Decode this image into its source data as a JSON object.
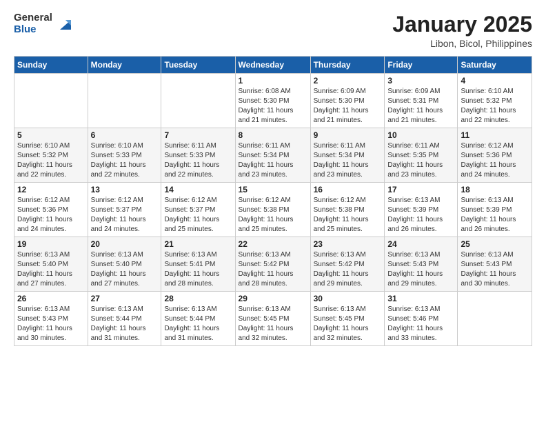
{
  "logo": {
    "general": "General",
    "blue": "Blue"
  },
  "title": "January 2025",
  "subtitle": "Libon, Bicol, Philippines",
  "days_header": [
    "Sunday",
    "Monday",
    "Tuesday",
    "Wednesday",
    "Thursday",
    "Friday",
    "Saturday"
  ],
  "weeks": [
    [
      {
        "day": "",
        "info": ""
      },
      {
        "day": "",
        "info": ""
      },
      {
        "day": "",
        "info": ""
      },
      {
        "day": "1",
        "info": "Sunrise: 6:08 AM\nSunset: 5:30 PM\nDaylight: 11 hours\nand 21 minutes."
      },
      {
        "day": "2",
        "info": "Sunrise: 6:09 AM\nSunset: 5:30 PM\nDaylight: 11 hours\nand 21 minutes."
      },
      {
        "day": "3",
        "info": "Sunrise: 6:09 AM\nSunset: 5:31 PM\nDaylight: 11 hours\nand 21 minutes."
      },
      {
        "day": "4",
        "info": "Sunrise: 6:10 AM\nSunset: 5:32 PM\nDaylight: 11 hours\nand 22 minutes."
      }
    ],
    [
      {
        "day": "5",
        "info": "Sunrise: 6:10 AM\nSunset: 5:32 PM\nDaylight: 11 hours\nand 22 minutes."
      },
      {
        "day": "6",
        "info": "Sunrise: 6:10 AM\nSunset: 5:33 PM\nDaylight: 11 hours\nand 22 minutes."
      },
      {
        "day": "7",
        "info": "Sunrise: 6:11 AM\nSunset: 5:33 PM\nDaylight: 11 hours\nand 22 minutes."
      },
      {
        "day": "8",
        "info": "Sunrise: 6:11 AM\nSunset: 5:34 PM\nDaylight: 11 hours\nand 23 minutes."
      },
      {
        "day": "9",
        "info": "Sunrise: 6:11 AM\nSunset: 5:34 PM\nDaylight: 11 hours\nand 23 minutes."
      },
      {
        "day": "10",
        "info": "Sunrise: 6:11 AM\nSunset: 5:35 PM\nDaylight: 11 hours\nand 23 minutes."
      },
      {
        "day": "11",
        "info": "Sunrise: 6:12 AM\nSunset: 5:36 PM\nDaylight: 11 hours\nand 24 minutes."
      }
    ],
    [
      {
        "day": "12",
        "info": "Sunrise: 6:12 AM\nSunset: 5:36 PM\nDaylight: 11 hours\nand 24 minutes."
      },
      {
        "day": "13",
        "info": "Sunrise: 6:12 AM\nSunset: 5:37 PM\nDaylight: 11 hours\nand 24 minutes."
      },
      {
        "day": "14",
        "info": "Sunrise: 6:12 AM\nSunset: 5:37 PM\nDaylight: 11 hours\nand 25 minutes."
      },
      {
        "day": "15",
        "info": "Sunrise: 6:12 AM\nSunset: 5:38 PM\nDaylight: 11 hours\nand 25 minutes."
      },
      {
        "day": "16",
        "info": "Sunrise: 6:12 AM\nSunset: 5:38 PM\nDaylight: 11 hours\nand 25 minutes."
      },
      {
        "day": "17",
        "info": "Sunrise: 6:13 AM\nSunset: 5:39 PM\nDaylight: 11 hours\nand 26 minutes."
      },
      {
        "day": "18",
        "info": "Sunrise: 6:13 AM\nSunset: 5:39 PM\nDaylight: 11 hours\nand 26 minutes."
      }
    ],
    [
      {
        "day": "19",
        "info": "Sunrise: 6:13 AM\nSunset: 5:40 PM\nDaylight: 11 hours\nand 27 minutes."
      },
      {
        "day": "20",
        "info": "Sunrise: 6:13 AM\nSunset: 5:40 PM\nDaylight: 11 hours\nand 27 minutes."
      },
      {
        "day": "21",
        "info": "Sunrise: 6:13 AM\nSunset: 5:41 PM\nDaylight: 11 hours\nand 28 minutes."
      },
      {
        "day": "22",
        "info": "Sunrise: 6:13 AM\nSunset: 5:42 PM\nDaylight: 11 hours\nand 28 minutes."
      },
      {
        "day": "23",
        "info": "Sunrise: 6:13 AM\nSunset: 5:42 PM\nDaylight: 11 hours\nand 29 minutes."
      },
      {
        "day": "24",
        "info": "Sunrise: 6:13 AM\nSunset: 5:43 PM\nDaylight: 11 hours\nand 29 minutes."
      },
      {
        "day": "25",
        "info": "Sunrise: 6:13 AM\nSunset: 5:43 PM\nDaylight: 11 hours\nand 30 minutes."
      }
    ],
    [
      {
        "day": "26",
        "info": "Sunrise: 6:13 AM\nSunset: 5:43 PM\nDaylight: 11 hours\nand 30 minutes."
      },
      {
        "day": "27",
        "info": "Sunrise: 6:13 AM\nSunset: 5:44 PM\nDaylight: 11 hours\nand 31 minutes."
      },
      {
        "day": "28",
        "info": "Sunrise: 6:13 AM\nSunset: 5:44 PM\nDaylight: 11 hours\nand 31 minutes."
      },
      {
        "day": "29",
        "info": "Sunrise: 6:13 AM\nSunset: 5:45 PM\nDaylight: 11 hours\nand 32 minutes."
      },
      {
        "day": "30",
        "info": "Sunrise: 6:13 AM\nSunset: 5:45 PM\nDaylight: 11 hours\nand 32 minutes."
      },
      {
        "day": "31",
        "info": "Sunrise: 6:13 AM\nSunset: 5:46 PM\nDaylight: 11 hours\nand 33 minutes."
      },
      {
        "day": "",
        "info": ""
      }
    ]
  ]
}
